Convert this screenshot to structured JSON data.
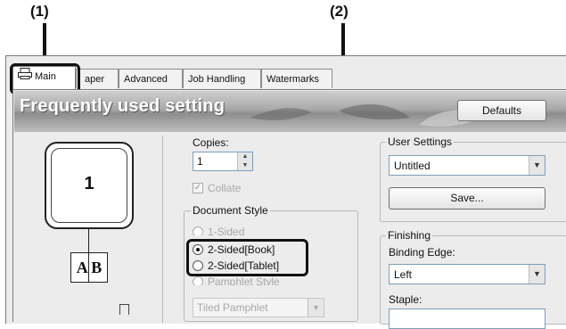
{
  "callouts": {
    "one": "(1)",
    "two": "(2)"
  },
  "tabs": [
    {
      "label": "Main",
      "active": true
    },
    {
      "label": "aper"
    },
    {
      "label": "Advanced"
    },
    {
      "label": "Job Handling"
    },
    {
      "label": "Watermarks"
    }
  ],
  "banner": {
    "title": "Frequently used setting",
    "defaults_button": "Defaults"
  },
  "preview": {
    "page_number": "1",
    "book_icon_text": "A B"
  },
  "copies": {
    "label": "Copies:",
    "value": "1"
  },
  "collate": {
    "label": "Collate",
    "checked": true,
    "disabled": true
  },
  "document_style": {
    "label": "Document Style",
    "options": [
      "1-Sided",
      "2-Sided[Book]",
      "2-Sided[Tablet]",
      "Pamphlet Style"
    ],
    "selected": "2-Sided[Book]",
    "pamphlet_select": "Tiled Pamphlet"
  },
  "user_settings": {
    "label": "User Settings",
    "value": "Untitled",
    "save_button": "Save..."
  },
  "finishing": {
    "label": "Finishing",
    "binding_edge_label": "Binding Edge:",
    "binding_edge_value": "Left",
    "staple_label": "Staple:"
  },
  "colors": {
    "accent": "#111111",
    "window_bg": "#ececec",
    "banner": "#9a9a9a"
  },
  "icons": [
    "printer-icon",
    "book-icon",
    "chevron-down-icon",
    "spinner-icon"
  ]
}
